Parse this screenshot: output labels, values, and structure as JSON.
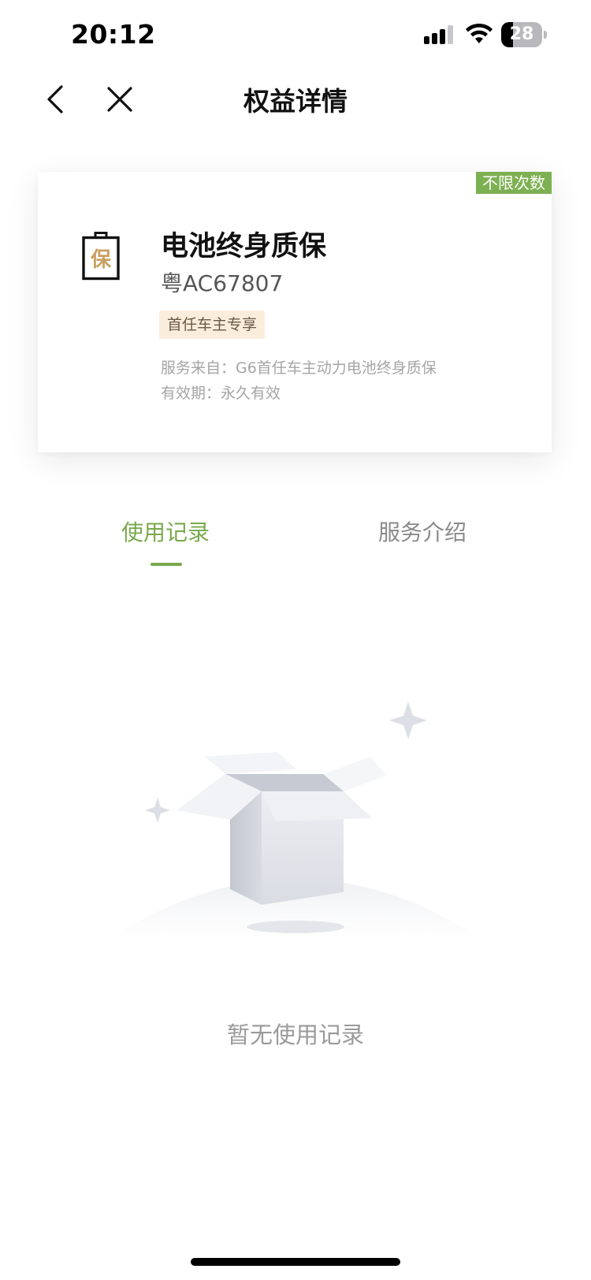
{
  "status_bar": {
    "time": "20:12",
    "battery_level": "28",
    "battery_fraction": 0.28
  },
  "nav": {
    "title": "权益详情",
    "back_icon": "chevron-left-icon",
    "close_icon": "close-icon"
  },
  "benefit_card": {
    "badge": "不限次数",
    "icon_glyph": "保",
    "icon": "battery-warranty-icon",
    "title": "电池终身质保",
    "plate": "粤AC67807",
    "tag": "首任车主专享",
    "service_source": "服务来自：G6首任车主动力电池终身质保",
    "validity": "有效期：永久有效"
  },
  "tabs": [
    {
      "label": "使用记录",
      "active": true
    },
    {
      "label": "服务介绍",
      "active": false
    }
  ],
  "empty_state": {
    "text": "暂无使用记录",
    "icon": "empty-box-icon"
  },
  "colors": {
    "accent_green": "#78a94c",
    "badge_green": "#7db052",
    "tag_background": "#fbeddc",
    "icon_gold": "#c9a060"
  }
}
